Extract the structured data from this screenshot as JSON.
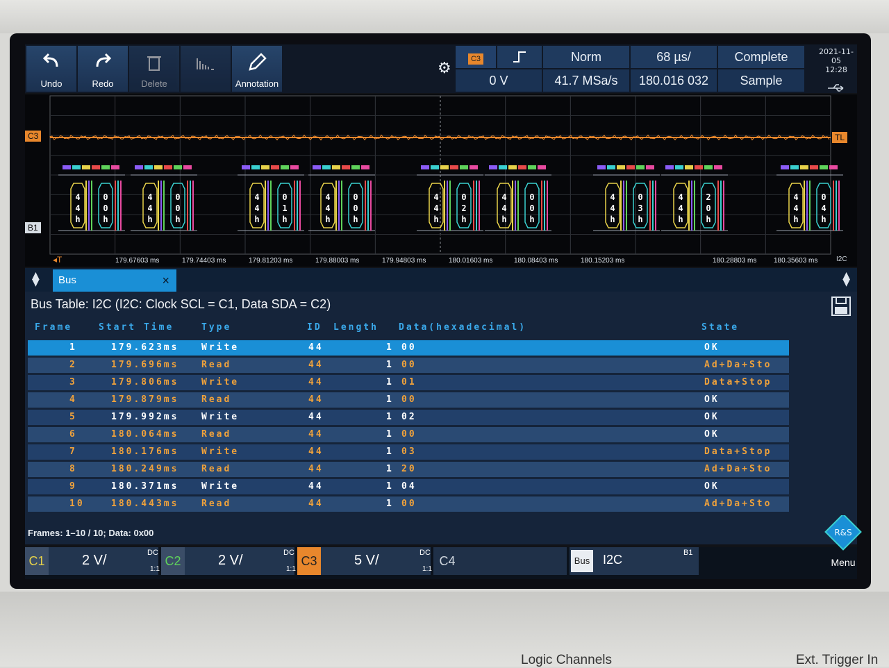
{
  "toolbar": {
    "undo": "Undo",
    "redo": "Redo",
    "delete": "Delete",
    "histogram": "",
    "annotation": "Annotation"
  },
  "trigger": {
    "source": "C3",
    "level": "0 V",
    "mode": "Norm",
    "sample_rate": "41.7 MSa/s",
    "time_scale": "68 µs/",
    "position": "180.016 032 ms",
    "acquisition": "Complete",
    "sampling": "Sample"
  },
  "datetime": {
    "date": "2021-11-05",
    "time": "12:28"
  },
  "waveform": {
    "c3_label": "C3",
    "trigger_level_label": "TL",
    "bus_label": "B1",
    "time_marker": "T",
    "time_ticks": [
      "179.67603 ms",
      "179.74403 ms",
      "179.81203 ms",
      "179.88003 ms",
      "179.94803 ms",
      "180.01603 ms",
      "180.08403 ms",
      "180.15203 ms",
      "180.28803 ms",
      "180.35603 ms"
    ],
    "i2c_tag": "I2C",
    "frames": [
      {
        "addr": [
          "4",
          "4",
          "h"
        ],
        "data": [
          "0",
          "0",
          "h"
        ]
      },
      {
        "addr": [
          "4",
          "4",
          "h"
        ],
        "data": [
          "0",
          "0",
          "h"
        ]
      },
      {
        "addr": [
          "4",
          "4",
          "h"
        ],
        "data": [
          "0",
          "1",
          "h"
        ]
      },
      {
        "addr": [
          "4",
          "4",
          "h"
        ],
        "data": [
          "0",
          "0",
          "h"
        ]
      },
      {
        "addr": [
          "4",
          "4",
          "h"
        ],
        "data": [
          "0",
          "2",
          "h"
        ]
      },
      {
        "addr": [
          "4",
          "4",
          "h"
        ],
        "data": [
          "0",
          "0",
          "h"
        ]
      },
      {
        "addr": [
          "4",
          "4",
          "h"
        ],
        "data": [
          "0",
          "3",
          "h"
        ]
      },
      {
        "addr": [
          "4",
          "4",
          "h"
        ],
        "data": [
          "2",
          "0",
          "h"
        ]
      },
      {
        "addr": [
          "4",
          "4",
          "h"
        ],
        "data": [
          "0",
          "4",
          "h"
        ]
      }
    ]
  },
  "bus_tab": {
    "label": "Bus",
    "close": "×"
  },
  "bus_table": {
    "title": "Bus Table: I2C (I2C: Clock SCL = C1, Data SDA = C2)",
    "columns": [
      "Frame",
      "Start Time",
      "Type",
      "ID",
      "Length",
      "Data(hexadecimal)",
      "State"
    ],
    "rows": [
      {
        "frame": "1",
        "start": "179.623ms",
        "type": "Write",
        "id": "44",
        "length": "1",
        "data": "00",
        "state": "OK"
      },
      {
        "frame": "2",
        "start": "179.696ms",
        "type": "Read",
        "id": "44",
        "length": "1",
        "data": "00",
        "state": "Ad+Da+Sto"
      },
      {
        "frame": "3",
        "start": "179.806ms",
        "type": "Write",
        "id": "44",
        "length": "1",
        "data": "01",
        "state": "Data+Stop"
      },
      {
        "frame": "4",
        "start": "179.879ms",
        "type": "Read",
        "id": "44",
        "length": "1",
        "data": "00",
        "state": "OK"
      },
      {
        "frame": "5",
        "start": "179.992ms",
        "type": "Write",
        "id": "44",
        "length": "1",
        "data": "02",
        "state": "OK"
      },
      {
        "frame": "6",
        "start": "180.064ms",
        "type": "Read",
        "id": "44",
        "length": "1",
        "data": "00",
        "state": "OK"
      },
      {
        "frame": "7",
        "start": "180.176ms",
        "type": "Write",
        "id": "44",
        "length": "1",
        "data": "03",
        "state": "Data+Stop"
      },
      {
        "frame": "8",
        "start": "180.249ms",
        "type": "Read",
        "id": "44",
        "length": "1",
        "data": "20",
        "state": "Ad+Da+Sto"
      },
      {
        "frame": "9",
        "start": "180.371ms",
        "type": "Write",
        "id": "44",
        "length": "1",
        "data": "04",
        "state": "OK"
      },
      {
        "frame": "10",
        "start": "180.443ms",
        "type": "Read",
        "id": "44",
        "length": "1",
        "data": "00",
        "state": "Ad+Da+Sto"
      }
    ],
    "footer": "Frames:  1–10 / 10; Data: 0x00"
  },
  "channels": [
    {
      "name": "C1",
      "scale": "2 V/",
      "coupling": "DC",
      "probe": "1:1",
      "color": "#e7d24a"
    },
    {
      "name": "C2",
      "scale": "2 V/",
      "coupling": "DC",
      "probe": "1:1",
      "color": "#5fd35b"
    },
    {
      "name": "C3",
      "scale": "5 V/",
      "coupling": "DC",
      "probe": "1:1",
      "color": "#e8872c"
    },
    {
      "name": "C4",
      "scale": "",
      "coupling": "",
      "probe": "",
      "color": "#cfd6de"
    }
  ],
  "bus_indicator": {
    "label": "Bus",
    "protocol": "I2C",
    "id": "B1"
  },
  "menu": {
    "label": "Menu"
  },
  "bezel": {
    "bottom_left": "Logic Channels",
    "bottom_right": "Ext. Trigger In"
  },
  "colors": {
    "accent": "#1a8fd6",
    "selected_row": "#1a8fd6",
    "c3": "#e8872c"
  }
}
